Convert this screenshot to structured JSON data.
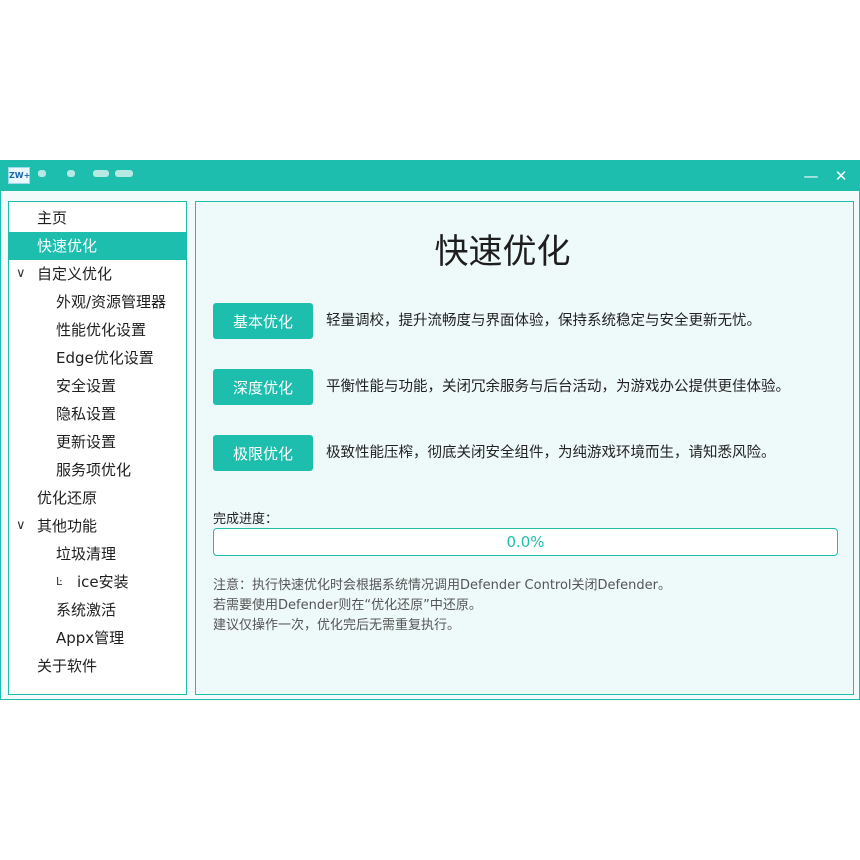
{
  "colors": {
    "accent": "#1ebeae",
    "panel_bg": "#eef9f9",
    "text": "#1e1e1e"
  },
  "titlebar": {
    "app_icon_text": "ZW+",
    "minimize_icon": "minimize-icon",
    "close_icon": "close-icon"
  },
  "sidebar": {
    "items": [
      {
        "label": "主页",
        "level": 0,
        "selected": false
      },
      {
        "label": "快速优化",
        "level": 0,
        "selected": true
      },
      {
        "label": "自定义优化",
        "level": 0,
        "expanded": true
      },
      {
        "label": "外观/资源管理器",
        "level": 1
      },
      {
        "label": "性能优化设置",
        "level": 1
      },
      {
        "label": "Edge优化设置",
        "level": 1
      },
      {
        "label": "安全设置",
        "level": 1
      },
      {
        "label": "隐私设置",
        "level": 1
      },
      {
        "label": "更新设置",
        "level": 1
      },
      {
        "label": "服务项优化",
        "level": 1
      },
      {
        "label": "优化还原",
        "level": 0
      },
      {
        "label": "其他功能",
        "level": 0,
        "expanded": true
      },
      {
        "label": "垃圾清理",
        "level": 1
      },
      {
        "label": "ice安装",
        "level": 1
      },
      {
        "label": "系统激活",
        "level": 1
      },
      {
        "label": "Appx管理",
        "level": 1
      },
      {
        "label": "关于软件",
        "level": 0
      }
    ]
  },
  "main": {
    "title": "快速优化",
    "options": [
      {
        "button": "基本优化",
        "description": "轻量调校，提升流畅度与界面体验，保持系统稳定与安全更新无忧。"
      },
      {
        "button": "深度优化",
        "description": "平衡性能与功能，关闭冗余服务与后台活动，为游戏办公提供更佳体验。"
      },
      {
        "button": "极限优化",
        "description": "极致性能压榨，彻底关闭安全组件，为纯游戏环境而生，请知悉风险。"
      }
    ],
    "progress_label": "完成进度：",
    "progress_value": 0.0,
    "progress_text": "0.0%",
    "notes": [
      "注意：执行快速优化时会根据系统情况调用Defender Control关闭Defender。",
      "若需要使用Defender则在“优化还原”中还原。",
      "建议仅操作一次，优化完后无需重复执行。"
    ]
  }
}
